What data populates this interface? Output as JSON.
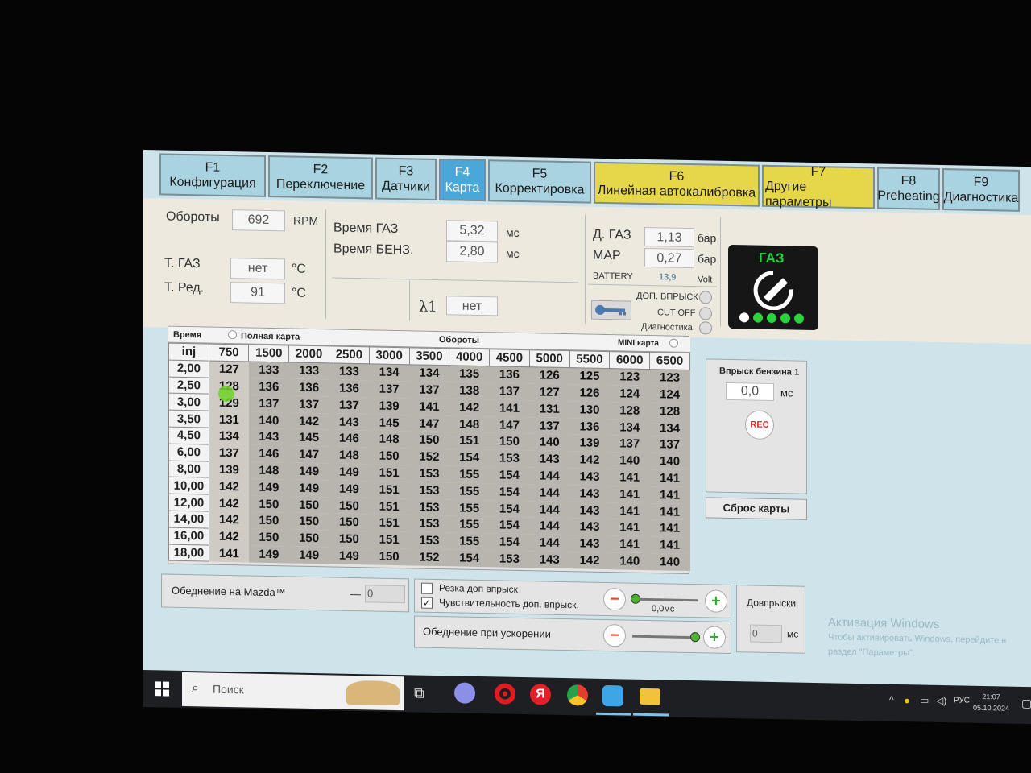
{
  "tabs": [
    {
      "key": "F1",
      "label": "Конфигурация",
      "style": "normal"
    },
    {
      "key": "F2",
      "label": "Переключение",
      "style": "normal"
    },
    {
      "key": "F3",
      "label": "Датчики",
      "style": "normal"
    },
    {
      "key": "F4",
      "label": "Карта",
      "style": "active"
    },
    {
      "key": "F5",
      "label": "Корректировка",
      "style": "normal"
    },
    {
      "key": "F6",
      "label": "Линейная автокалибровка",
      "style": "yellow"
    },
    {
      "key": "F7",
      "label": "Другие параметры",
      "style": "yellow"
    },
    {
      "key": "F8",
      "label": "Preheating",
      "style": "normal"
    },
    {
      "key": "F9",
      "label": "Диагностика",
      "style": "normal"
    }
  ],
  "status": {
    "rpm_label": "Обороты",
    "rpm_value": "692",
    "rpm_unit": "RPM",
    "tgas_label": "Т. ГАЗ",
    "tgas_value": "нет",
    "tgas_unit": "°C",
    "tred_label": "Т. Ред.",
    "tred_value": "91",
    "tred_unit": "°C",
    "gas_time_label": "Время ГАЗ",
    "gas_time_value": "5,32",
    "gas_time_unit": "мс",
    "petrol_time_label": "Время БЕНЗ.",
    "petrol_time_value": "2,80",
    "petrol_time_unit": "мс",
    "lambda_label": "λ1",
    "lambda_value": "нет",
    "dgas_label": "Д. ГАЗ",
    "dgas_value": "1,13",
    "dgas_unit": "бар",
    "map_label": "MAP",
    "map_value": "0,27",
    "map_unit": "бар",
    "battery_label": "BATTERY",
    "battery_value": "13,9",
    "battery_unit": "Volt",
    "extra_injection": "ДОП. ВПРЫСК",
    "cut_off": "CUT OFF",
    "diagnostics": "Диагностика",
    "gas_badge": "ГАЗ"
  },
  "map": {
    "header_time": "Время",
    "header_inj": "inj",
    "full_map": "Полная карта",
    "rpm_title": "Обороты",
    "mini_map": "MINI карта",
    "columns": [
      "750",
      "1500",
      "2000",
      "2500",
      "3000",
      "3500",
      "4000",
      "4500",
      "5000",
      "5500",
      "6000",
      "6500"
    ],
    "rows": [
      {
        "t": "2,00",
        "v": [
          "127",
          "133",
          "133",
          "133",
          "134",
          "134",
          "135",
          "136",
          "126",
          "125",
          "123",
          "123"
        ]
      },
      {
        "t": "2,50",
        "v": [
          "128",
          "136",
          "136",
          "136",
          "137",
          "137",
          "138",
          "137",
          "127",
          "126",
          "124",
          "124"
        ]
      },
      {
        "t": "3,00",
        "v": [
          "129",
          "137",
          "137",
          "137",
          "139",
          "141",
          "142",
          "141",
          "131",
          "130",
          "128",
          "128"
        ]
      },
      {
        "t": "3,50",
        "v": [
          "131",
          "140",
          "142",
          "143",
          "145",
          "147",
          "148",
          "147",
          "137",
          "136",
          "134",
          "134"
        ]
      },
      {
        "t": "4,50",
        "v": [
          "134",
          "143",
          "145",
          "146",
          "148",
          "150",
          "151",
          "150",
          "140",
          "139",
          "137",
          "137"
        ]
      },
      {
        "t": "6,00",
        "v": [
          "137",
          "146",
          "147",
          "148",
          "150",
          "152",
          "154",
          "153",
          "143",
          "142",
          "140",
          "140"
        ]
      },
      {
        "t": "8,00",
        "v": [
          "139",
          "148",
          "149",
          "149",
          "151",
          "153",
          "155",
          "154",
          "144",
          "143",
          "141",
          "141"
        ]
      },
      {
        "t": "10,00",
        "v": [
          "142",
          "149",
          "149",
          "149",
          "151",
          "153",
          "155",
          "154",
          "144",
          "143",
          "141",
          "141"
        ]
      },
      {
        "t": "12,00",
        "v": [
          "142",
          "150",
          "150",
          "150",
          "151",
          "153",
          "155",
          "154",
          "144",
          "143",
          "141",
          "141"
        ]
      },
      {
        "t": "14,00",
        "v": [
          "142",
          "150",
          "150",
          "150",
          "151",
          "153",
          "155",
          "154",
          "144",
          "143",
          "141",
          "141"
        ]
      },
      {
        "t": "16,00",
        "v": [
          "142",
          "150",
          "150",
          "150",
          "151",
          "153",
          "155",
          "154",
          "144",
          "143",
          "141",
          "141"
        ]
      },
      {
        "t": "18,00",
        "v": [
          "141",
          "149",
          "149",
          "149",
          "150",
          "152",
          "154",
          "153",
          "143",
          "142",
          "140",
          "140"
        ]
      }
    ]
  },
  "side": {
    "petrol_injection_title": "Впрыск бензина 1",
    "petrol_injection_value": "0,0",
    "petrol_injection_unit": "мс",
    "rec": "REC",
    "reset_map": "Сброс карты"
  },
  "bottom": {
    "mazda_label": "Обеднение на Mazda™",
    "mazda_dash": "—",
    "mazda_value": "0",
    "cut_extra": "Резка доп впрыск",
    "sens_extra": "Чувствительность доп. впрыск.",
    "sens_value": "0,0мс",
    "accel_lean": "Обеднение при ускорении",
    "extra_inj_title": "Довпрыски",
    "extra_inj_value": "0",
    "extra_inj_unit": "мс"
  },
  "watermark": {
    "line1": "Активация Windows",
    "line2": "Чтобы активировать Windows, перейдите в",
    "line3": "раздел \"Параметры\"."
  },
  "taskbar": {
    "search_placeholder": "Поиск",
    "lang": "РУС",
    "time": "21:07",
    "date": "05.10.2024"
  },
  "colors": {
    "accent": "#4aa8d8",
    "yellow_tab": "#e6d64a",
    "gas_green": "#2bd43c"
  }
}
